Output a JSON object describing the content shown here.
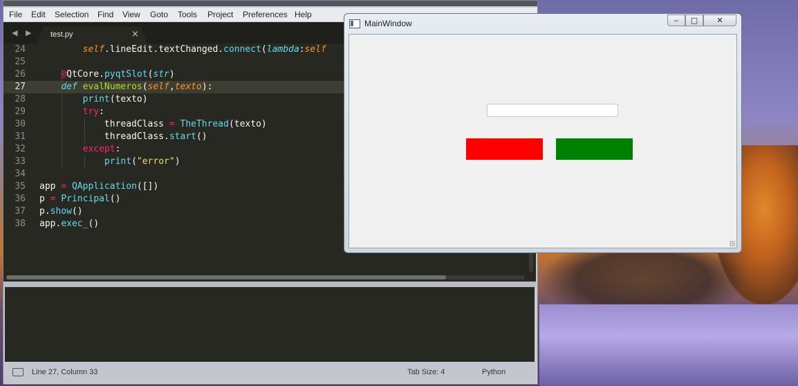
{
  "editor_window": {
    "menu": [
      "File",
      "Edit",
      "Selection",
      "Find",
      "View",
      "Goto",
      "Tools",
      "Project",
      "Preferences",
      "Help"
    ],
    "tab": {
      "label": "test.py"
    },
    "nav_arrows": "◀ ▶",
    "code_lines": [
      {
        "n": "24",
        "tokens": [
          [
            "        ",
            "pl"
          ],
          [
            "self",
            "it"
          ],
          [
            ".lineEdit.textChanged.",
            "pl"
          ],
          [
            "connect",
            "bl"
          ],
          [
            "(",
            "pl"
          ],
          [
            "lambda",
            "kwi"
          ],
          [
            ":",
            "pl"
          ],
          [
            "self",
            "it"
          ]
        ]
      },
      {
        "n": "25",
        "tokens": []
      },
      {
        "n": "26",
        "tokens": [
          [
            "    ",
            "pl"
          ],
          [
            "@",
            "red"
          ],
          [
            "QtCore.",
            "pl"
          ],
          [
            "pyqtSlot",
            "bl"
          ],
          [
            "(",
            "pl"
          ],
          [
            "str",
            "kwi"
          ],
          [
            ")",
            "pl"
          ]
        ]
      },
      {
        "n": "27",
        "tokens": [
          [
            "    ",
            "pl"
          ],
          [
            "def",
            "kwi"
          ],
          [
            " ",
            "pl"
          ],
          [
            "evalNumeros",
            "gr"
          ],
          [
            "(",
            "pl"
          ],
          [
            "self",
            "it"
          ],
          [
            ",",
            "pl"
          ],
          [
            "texto",
            "it"
          ],
          [
            "):",
            "pl"
          ]
        ]
      },
      {
        "n": "28",
        "tokens": [
          [
            "        ",
            "pl"
          ],
          [
            "print",
            "bl"
          ],
          [
            "(texto)",
            "pl"
          ]
        ]
      },
      {
        "n": "29",
        "tokens": [
          [
            "        ",
            "pl"
          ],
          [
            "try",
            "red"
          ],
          [
            ":",
            "pl"
          ]
        ]
      },
      {
        "n": "30",
        "tokens": [
          [
            "            threadClass ",
            "pl"
          ],
          [
            "=",
            "red"
          ],
          [
            " ",
            "pl"
          ],
          [
            "TheThread",
            "bl"
          ],
          [
            "(texto)",
            "pl"
          ]
        ]
      },
      {
        "n": "31",
        "tokens": [
          [
            "            threadClass.",
            "pl"
          ],
          [
            "start",
            "bl"
          ],
          [
            "()",
            "pl"
          ]
        ]
      },
      {
        "n": "32",
        "tokens": [
          [
            "        ",
            "pl"
          ],
          [
            "except",
            "red"
          ],
          [
            ":",
            "pl"
          ]
        ]
      },
      {
        "n": "33",
        "tokens": [
          [
            "            ",
            "pl"
          ],
          [
            "print",
            "bl"
          ],
          [
            "(",
            "pl"
          ],
          [
            "\"error\"",
            "yl"
          ],
          [
            ")",
            "pl"
          ]
        ]
      },
      {
        "n": "34",
        "tokens": []
      },
      {
        "n": "35",
        "tokens": [
          [
            "app ",
            "pl"
          ],
          [
            "=",
            "red"
          ],
          [
            " ",
            "pl"
          ],
          [
            "QApplication",
            "bl"
          ],
          [
            "([])",
            "pl"
          ]
        ]
      },
      {
        "n": "36",
        "tokens": [
          [
            "p ",
            "pl"
          ],
          [
            "=",
            "red"
          ],
          [
            " ",
            "pl"
          ],
          [
            "Principal",
            "bl"
          ],
          [
            "()",
            "pl"
          ]
        ]
      },
      {
        "n": "37",
        "tokens": [
          [
            "p.",
            "pl"
          ],
          [
            "show",
            "bl"
          ],
          [
            "()",
            "pl"
          ]
        ]
      },
      {
        "n": "38",
        "tokens": [
          [
            "app.",
            "pl"
          ],
          [
            "exec_",
            "bl"
          ],
          [
            "()",
            "pl"
          ]
        ]
      }
    ],
    "current_line": "27",
    "status": {
      "position": "Line 27, Column 33",
      "tab_size": "Tab Size: 4",
      "syntax": "Python"
    }
  },
  "qt_window": {
    "title": "MainWindow",
    "controls": {
      "minimize": "‒",
      "maximize": "□",
      "close": "✕"
    },
    "line_edit_value": "",
    "button_colors": {
      "left": "#ff0000",
      "right": "#008000"
    }
  }
}
